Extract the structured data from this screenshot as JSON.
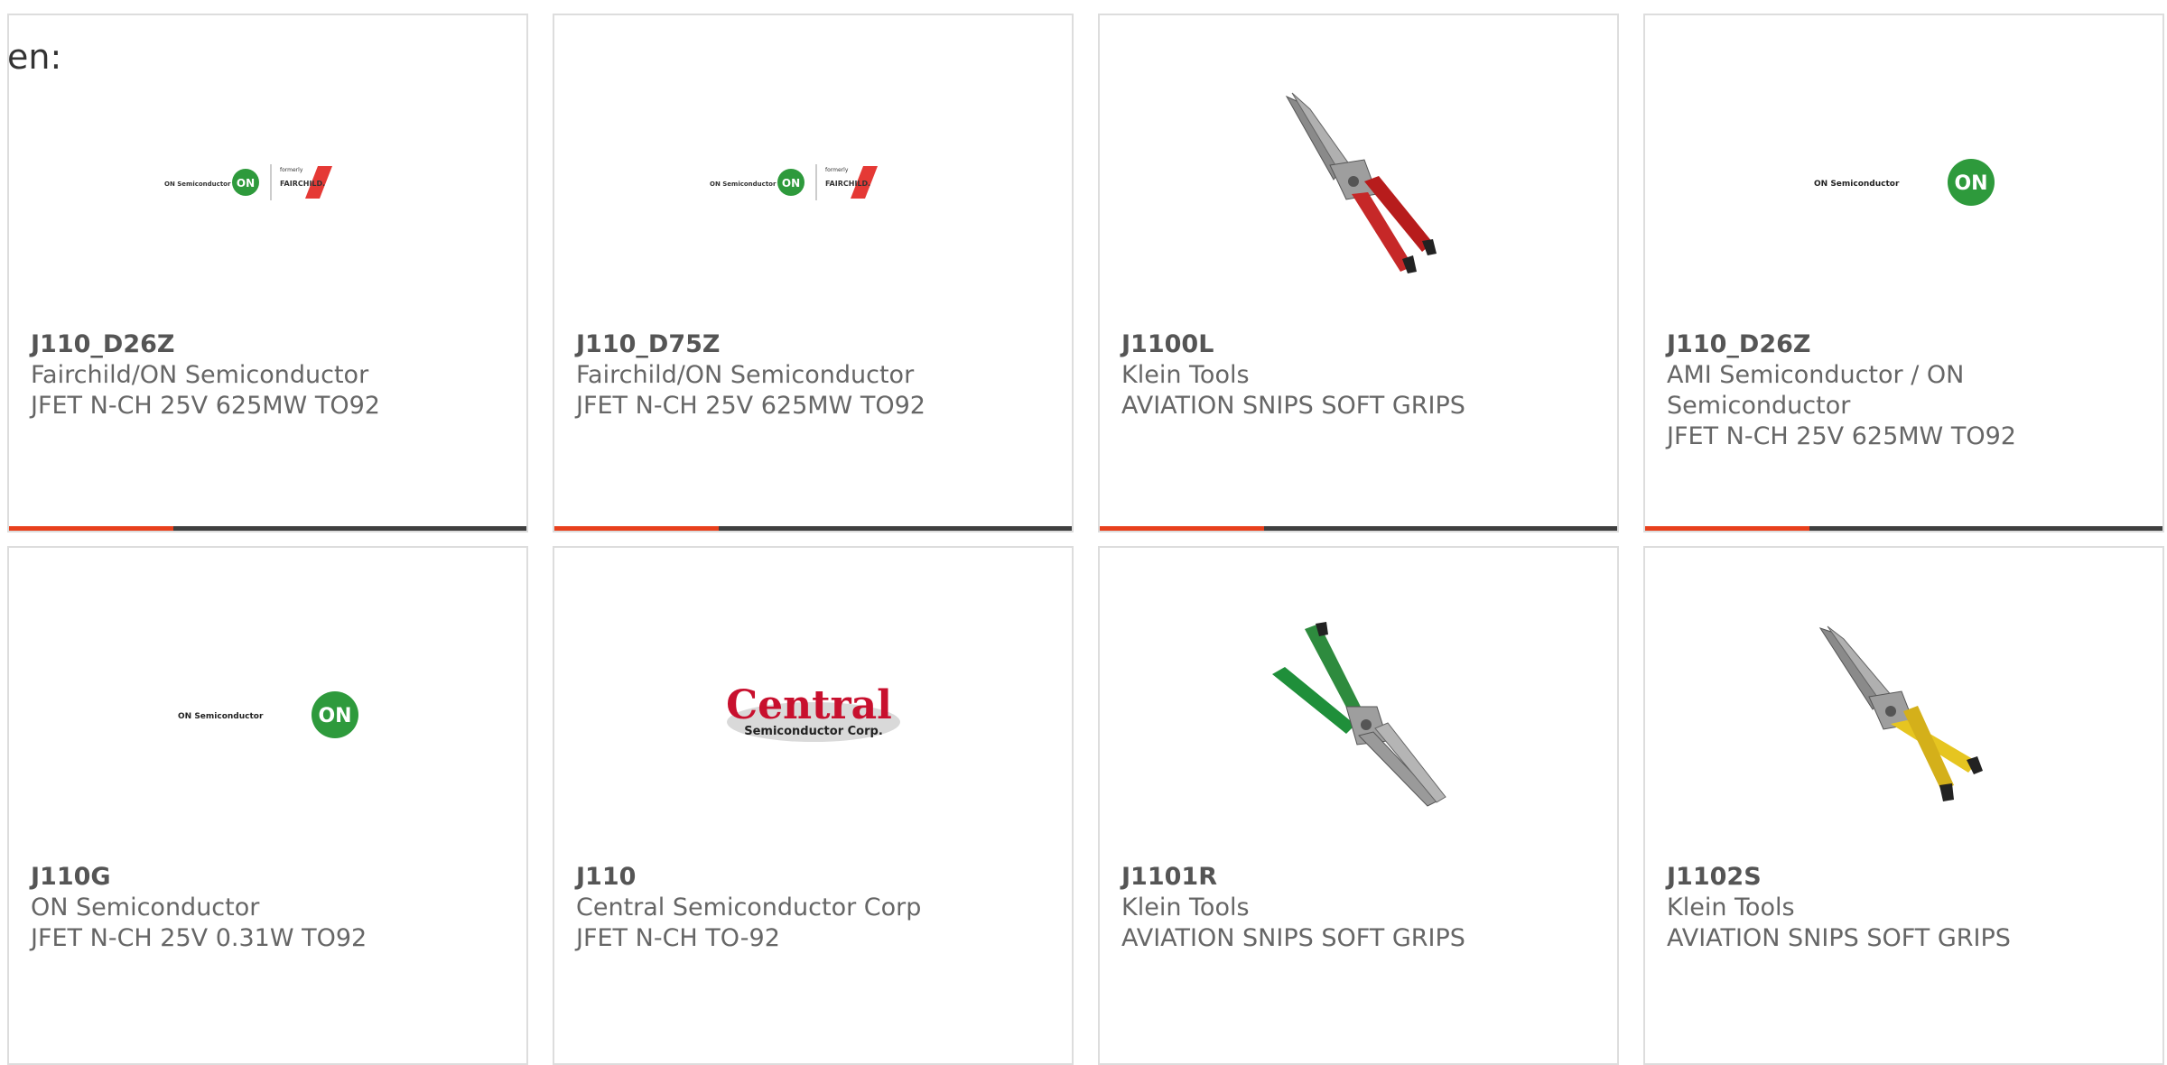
{
  "page": {
    "leading_text": "en:"
  },
  "colors": {
    "accent": "#e8401c",
    "bar_dark": "#3f3f3f",
    "on_green": "#2e9a3c",
    "fairchild_red": "#e53935",
    "central_red": "#c8102e"
  },
  "products": [
    {
      "part_number": "J110_D26Z",
      "manufacturer": "Fairchild/ON Semiconductor",
      "description": "JFET N-CH 25V 625MW TO92",
      "image": "on-fairchild-logo",
      "logo_text": {
        "on": "ON Semiconductor",
        "formerly": "formerly",
        "fairchild": "FAIRCHILD."
      }
    },
    {
      "part_number": "J110_D75Z",
      "manufacturer": "Fairchild/ON Semiconductor",
      "description": "JFET N-CH 25V 625MW TO92",
      "image": "on-fairchild-logo",
      "logo_text": {
        "on": "ON Semiconductor",
        "formerly": "formerly",
        "fairchild": "FAIRCHILD."
      }
    },
    {
      "part_number": "J1100L",
      "manufacturer": "Klein Tools",
      "description": "AVIATION SNIPS SOFT GRIPS",
      "image": "aviation-snips-red"
    },
    {
      "part_number": "J110_D26Z",
      "manufacturer": "AMI Semiconductor / ON Semiconductor",
      "description": "JFET N-CH 25V 625MW TO92",
      "image": "on-semiconductor-logo",
      "logo_text": {
        "on": "ON Semiconductor"
      }
    },
    {
      "part_number": "J110G",
      "manufacturer": "ON Semiconductor",
      "description": "JFET N-CH 25V 0.31W TO92",
      "image": "on-semiconductor-logo",
      "logo_text": {
        "on": "ON Semiconductor"
      }
    },
    {
      "part_number": "J110",
      "manufacturer": "Central Semiconductor Corp",
      "description": "JFET N-CH TO-92",
      "image": "central-semiconductor-logo",
      "logo_text": {
        "main": "Central",
        "sub": "Semiconductor Corp."
      }
    },
    {
      "part_number": "J1101R",
      "manufacturer": "Klein Tools",
      "description": "AVIATION SNIPS SOFT GRIPS",
      "image": "aviation-snips-green"
    },
    {
      "part_number": "J1102S",
      "manufacturer": "Klein Tools",
      "description": "AVIATION SNIPS SOFT GRIPS",
      "image": "aviation-snips-yellow"
    }
  ]
}
